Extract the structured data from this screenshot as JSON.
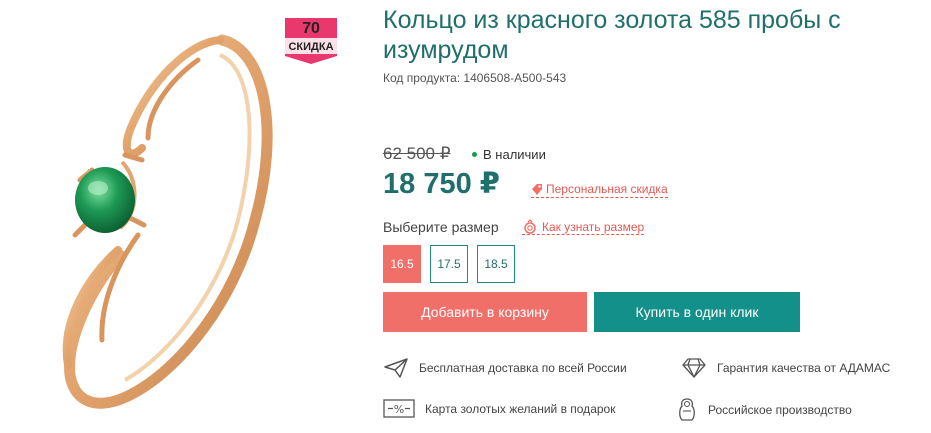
{
  "badge": {
    "number": "70",
    "label": "СКИДКА"
  },
  "product": {
    "title": "Кольцо из красного золота 585 пробы с изумрудом",
    "sku": "Код продукта: 1406508-А500-543"
  },
  "pricing": {
    "old_price": "62 500 ₽",
    "stock": "В наличии",
    "price": "18 750 ₽",
    "personal_discount": "Персональная скидка"
  },
  "size": {
    "label": "Выберите размер",
    "help_link": "Как узнать размер",
    "options": [
      "16.5",
      "17.5",
      "18.5"
    ],
    "selected": "16.5"
  },
  "actions": {
    "add_to_cart": "Добавить в корзину",
    "buy_one_click": "Купить в один клик"
  },
  "features": {
    "delivery": "Бесплатная доставка по всей России",
    "guarantee": "Гарантия качества от АДАМАС",
    "gift_card": "Карта золотых желаний в подарок",
    "made_in": "Российское производство"
  },
  "colors": {
    "accent_red": "#f07069",
    "accent_teal": "#13908a",
    "title_teal": "#1f6f6a",
    "badge_pink": "#e8386e",
    "gold": "#e3a56f",
    "emerald": "#1e9a55"
  },
  "icons": {
    "product_image": "gold-ring-emerald-image",
    "delivery": "paper-plane-icon",
    "guarantee": "diamond-icon",
    "gift_card": "percent-card-icon",
    "made_in": "matryoshka-icon",
    "discount_tag": "tag-icon",
    "size_help": "ring-size-icon"
  }
}
